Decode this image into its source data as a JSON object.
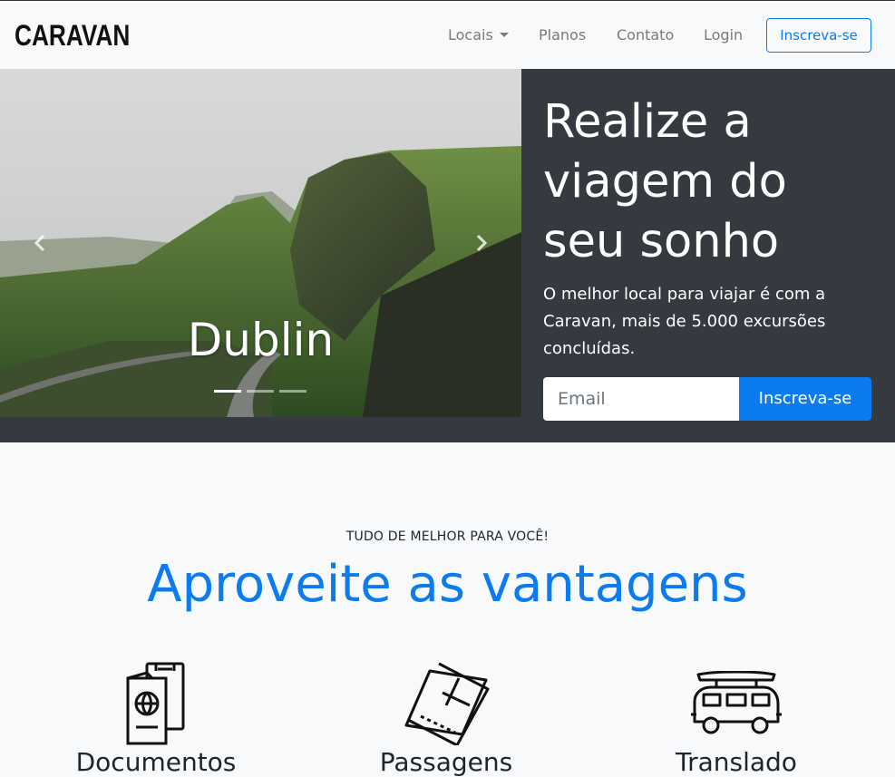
{
  "navbar": {
    "brand": "CARAVAN",
    "links": [
      "Locais",
      "Planos",
      "Contato",
      "Login"
    ],
    "cta": "Inscreva-se"
  },
  "hero": {
    "carousel": {
      "caption": "Dublin",
      "slide_count": 3,
      "active_index": 0
    },
    "title": "Realize a viagem do seu sonho",
    "text": "O melhor local para viajar é com a Caravan, mais de 5.000 excursões concluídas.",
    "email_placeholder": "Email",
    "submit_label": "Inscreva-se"
  },
  "features": {
    "eyebrow": "TUDO DE MELHOR PARA VOCÊ!",
    "title": "Aproveite as vantagens",
    "items": [
      {
        "label": "Documentos",
        "icon": "passport-icon"
      },
      {
        "label": "Passagens",
        "icon": "tickets-icon"
      },
      {
        "label": "Translado",
        "icon": "van-icon"
      }
    ]
  },
  "colors": {
    "primary": "#0d7bf0",
    "hero_bg": "#343a40",
    "page_bg": "#f8f9fa"
  }
}
